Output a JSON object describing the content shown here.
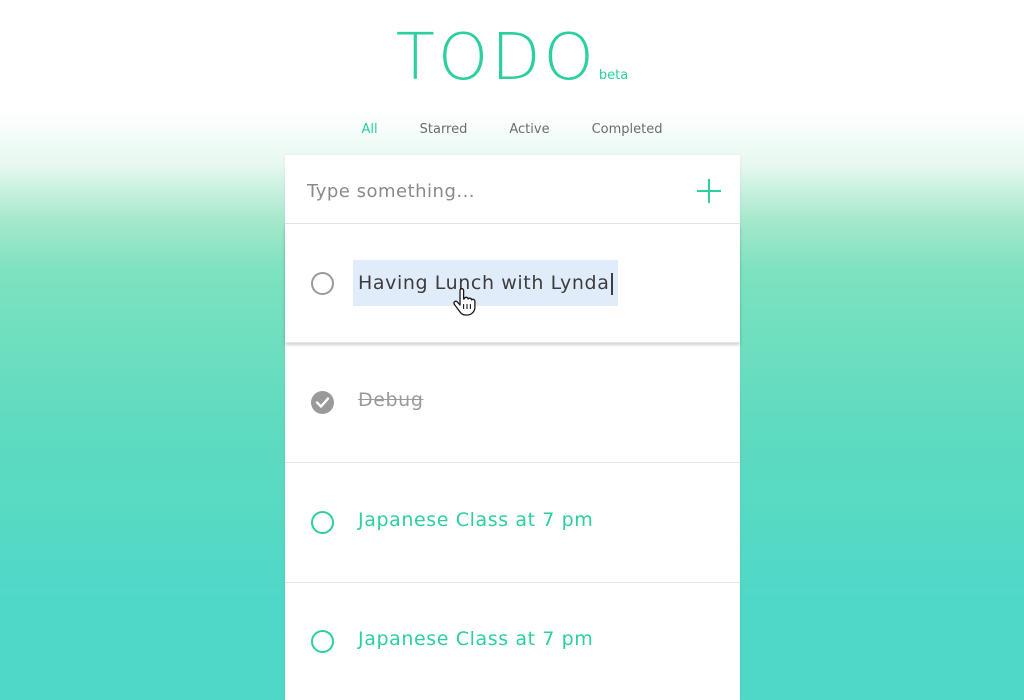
{
  "header": {
    "title": "TODO",
    "badge": "beta"
  },
  "filters": [
    {
      "label": "All",
      "active": true
    },
    {
      "label": "Starred",
      "active": false
    },
    {
      "label": "Active",
      "active": false
    },
    {
      "label": "Completed",
      "active": false
    }
  ],
  "new_todo": {
    "placeholder": "Type something...",
    "value": "",
    "add_icon": "plus-icon"
  },
  "todos": [
    {
      "text": "Having Lunch with Lynda",
      "state": "editing",
      "completed": false
    },
    {
      "text": "Debug",
      "state": "completed",
      "completed": true
    },
    {
      "text": "Japanese Class at 7 pm",
      "state": "active",
      "completed": false
    },
    {
      "text": "Japanese Class at 7 pm",
      "state": "active",
      "completed": false
    }
  ],
  "colors": {
    "accent": "#2ccfa0",
    "muted": "#9a9a9a",
    "selection": "#e0ecfa",
    "gradient_bottom": "#4ed8c8"
  }
}
